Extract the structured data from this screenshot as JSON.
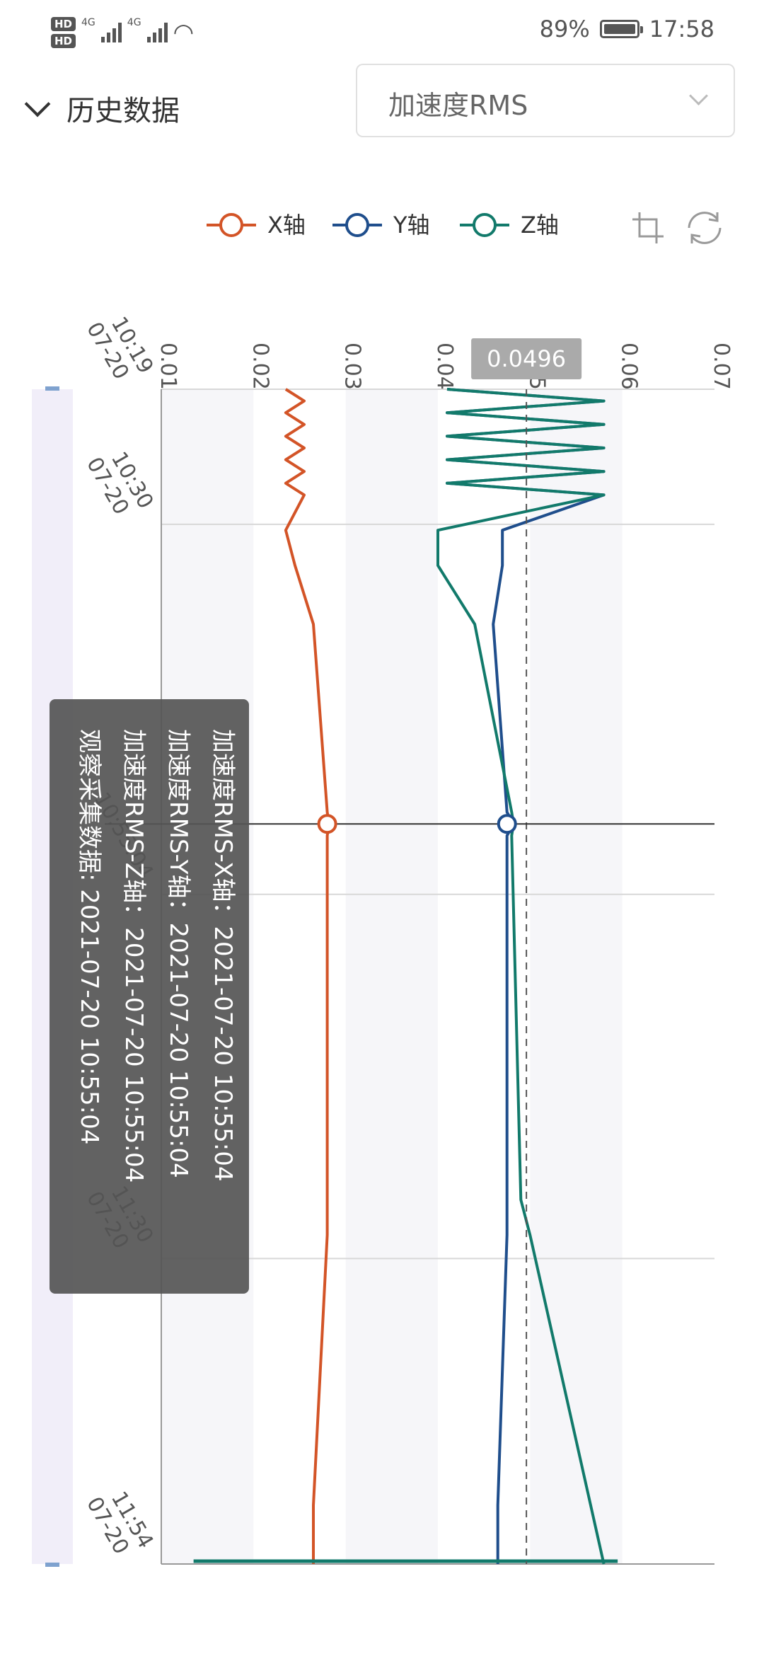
{
  "status_bar": {
    "hd1": "HD",
    "hd2": "HD",
    "net1": "4G",
    "net2": "4G",
    "battery_percent": "89%",
    "battery_level": 0.89,
    "time": "17:58"
  },
  "header": {
    "history_label": "历史数据",
    "metric_select": "加速度RMS"
  },
  "toolbox": {
    "zoom_icon": "data-zoom-icon",
    "reset_icon": "restore-icon"
  },
  "colors": {
    "x": "#d35427",
    "y": "#1f4e8c",
    "z": "#127a6b",
    "tooltip_bg": "#555555"
  },
  "chart_data": {
    "type": "line",
    "orientation": "rotated-90",
    "legend": [
      "X轴",
      "Y轴",
      "Z轴"
    ],
    "value_axis": {
      "min": 0.01,
      "max": 0.07,
      "ticks": [
        "0.01",
        "0.02",
        "0.03",
        "0.04",
        "0.05",
        "0.06",
        "0.07"
      ]
    },
    "time_axis": {
      "ticks": [
        {
          "time": "10:19",
          "date": "07-20"
        },
        {
          "time": "10:30",
          "date": "07-20"
        },
        {
          "time": "10:55:04",
          "date": ""
        },
        {
          "time": "11:30",
          "date": "07-20"
        },
        {
          "time": "11:54",
          "date": "07-20"
        }
      ]
    },
    "pointer_value": "0.0496",
    "series": [
      {
        "name": "X轴",
        "points": [
          [
            0,
            0.0235
          ],
          [
            1,
            0.0255
          ],
          [
            2,
            0.0235
          ],
          [
            3,
            0.0255
          ],
          [
            4,
            0.0235
          ],
          [
            5,
            0.0255
          ],
          [
            6,
            0.0235
          ],
          [
            7,
            0.0255
          ],
          [
            8,
            0.0235
          ],
          [
            9,
            0.0255
          ],
          [
            12,
            0.0235
          ],
          [
            15,
            0.0245
          ],
          [
            20,
            0.0265
          ],
          [
            36,
            0.028
          ],
          [
            37,
            0.0282
          ],
          [
            38,
            0.028
          ],
          [
            72,
            0.028
          ],
          [
            95,
            0.0265
          ],
          [
            100,
            0.0265
          ]
        ]
      },
      {
        "name": "Y轴",
        "points": [
          [
            0,
            0.041
          ],
          [
            1,
            0.058
          ],
          [
            2,
            0.041
          ],
          [
            3,
            0.058
          ],
          [
            4,
            0.041
          ],
          [
            5,
            0.058
          ],
          [
            6,
            0.041
          ],
          [
            7,
            0.058
          ],
          [
            8,
            0.041
          ],
          [
            9,
            0.058
          ],
          [
            12,
            0.047
          ],
          [
            15,
            0.047
          ],
          [
            20,
            0.046
          ],
          [
            36,
            0.0475
          ],
          [
            37,
            0.0482
          ],
          [
            38,
            0.0475
          ],
          [
            72,
            0.0475
          ],
          [
            95,
            0.0465
          ],
          [
            100,
            0.0465
          ]
        ]
      },
      {
        "name": "Z轴",
        "points": [
          [
            0,
            0.041
          ],
          [
            1,
            0.058
          ],
          [
            2,
            0.041
          ],
          [
            3,
            0.058
          ],
          [
            4,
            0.041
          ],
          [
            5,
            0.058
          ],
          [
            6,
            0.041
          ],
          [
            7,
            0.058
          ],
          [
            8,
            0.041
          ],
          [
            9,
            0.058
          ],
          [
            12,
            0.04
          ],
          [
            15,
            0.04
          ],
          [
            20,
            0.044
          ],
          [
            36,
            0.048
          ],
          [
            37,
            0.0482
          ],
          [
            38,
            0.048
          ],
          [
            69,
            0.049
          ],
          [
            72,
            0.05
          ],
          [
            100,
            0.058
          ]
        ]
      }
    ],
    "tooltip": {
      "rows": [
        "加速度RMS-X轴：2021-07-20 10:55:04",
        "加速度RMS-Y轴：2021-07-20 10:55:04",
        "加速度RMS-Z轴：2021-07-20 10:55:04",
        "观察采集数据: 2021-07-20 10:55:04"
      ]
    }
  }
}
